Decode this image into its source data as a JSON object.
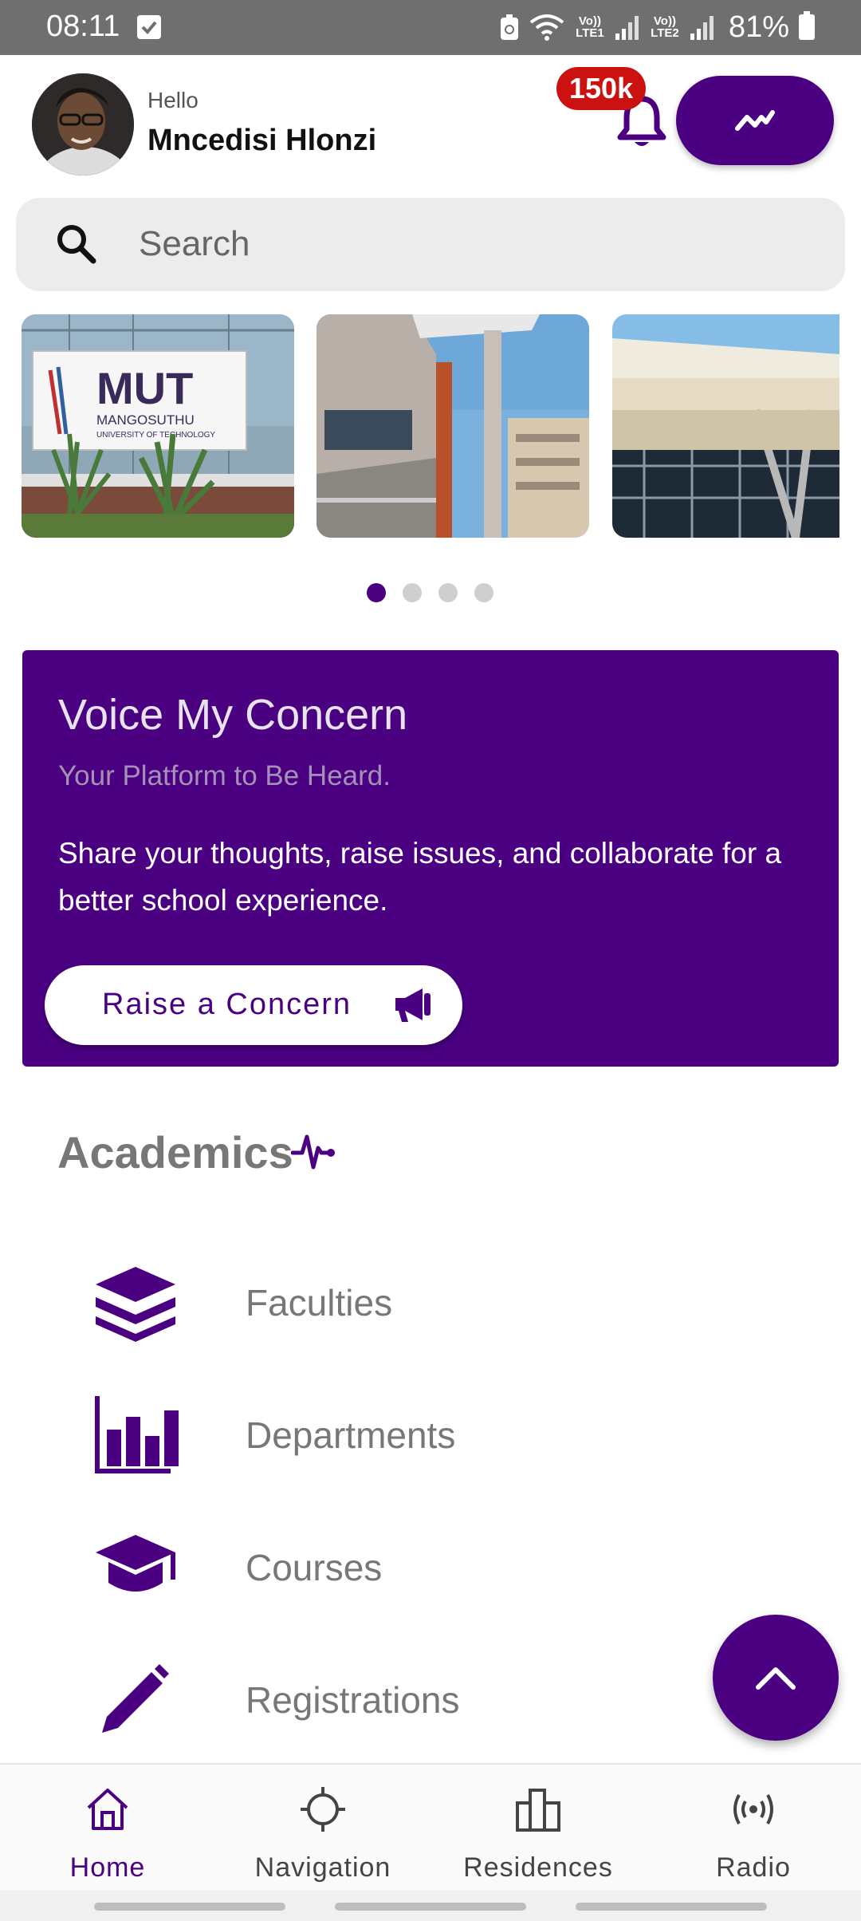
{
  "status_bar": {
    "time": "08:11",
    "sim1": "Vo)) LTE1",
    "sim2": "Vo)) LTE2",
    "battery": "81%"
  },
  "header": {
    "greeting": "Hello",
    "user_name": "Mncedisi Hlonzi",
    "notification_count": "150k"
  },
  "search": {
    "placeholder": "Search"
  },
  "carousel": {
    "slide_count": 4,
    "active_index": 0
  },
  "concern_card": {
    "title": "Voice My Concern",
    "subtitle": "Your Platform to Be Heard.",
    "body": "Share your thoughts, raise issues, and collaborate for a better school experience.",
    "button_label": "Raise a Concern"
  },
  "academics": {
    "title": "Academics",
    "items": [
      {
        "label": "Faculties",
        "icon": "layers-icon"
      },
      {
        "label": "Departments",
        "icon": "bar-chart-icon"
      },
      {
        "label": "Courses",
        "icon": "graduation-cap-icon"
      },
      {
        "label": "Registrations",
        "icon": "pencil-icon"
      }
    ]
  },
  "bottom_nav": {
    "items": [
      {
        "label": "Home",
        "icon": "home-icon",
        "active": true
      },
      {
        "label": "Navigation",
        "icon": "crosshair-icon",
        "active": false
      },
      {
        "label": "Residences",
        "icon": "buildings-icon",
        "active": false
      },
      {
        "label": "Radio",
        "icon": "broadcast-icon",
        "active": false
      }
    ]
  },
  "colors": {
    "accent": "#4b0082",
    "badge": "#cc1111",
    "status_bar": "#6f6f6f"
  }
}
